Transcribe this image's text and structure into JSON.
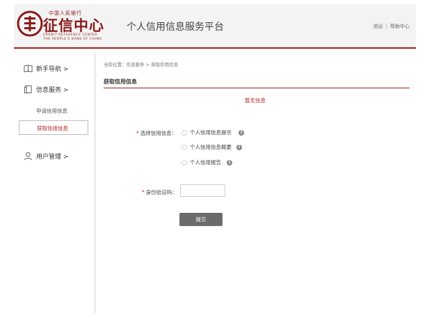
{
  "header": {
    "logo_top": "中国人民银行",
    "logo_title": "征信中心",
    "logo_en_line1": "CREDIT REFERENCE CENTER",
    "logo_en_line2": "THE PEOPLE'S BANK OF CHINA",
    "platform_title": "个人信用信息服务平台",
    "logout_label": "退出",
    "separator": "|",
    "help_label": "帮助中心"
  },
  "sidebar": {
    "guide_label": "新手导航 >",
    "info_service_label": "信息服务 >",
    "apply_label": "申请信用信息",
    "get_label": "获取信用信息",
    "user_mgmt_label": "用户管理 >"
  },
  "main": {
    "breadcrumb": "当前位置：信息服务 > 获取信用信息",
    "title": "获取信用信息",
    "notice": "暂无信息",
    "select_label": "选择信用信息：",
    "required_mark": "*",
    "options": [
      "个人信用信息提示",
      "个人信用信息概要",
      "个人信用报告"
    ],
    "info_glyph": "i",
    "code_label": "身份验证码：",
    "code_value": "",
    "submit_label": "提交"
  },
  "colors": {
    "brand_red": "#a61c1c",
    "active_red": "#b52525",
    "button_gray": "#6b6b6b"
  }
}
